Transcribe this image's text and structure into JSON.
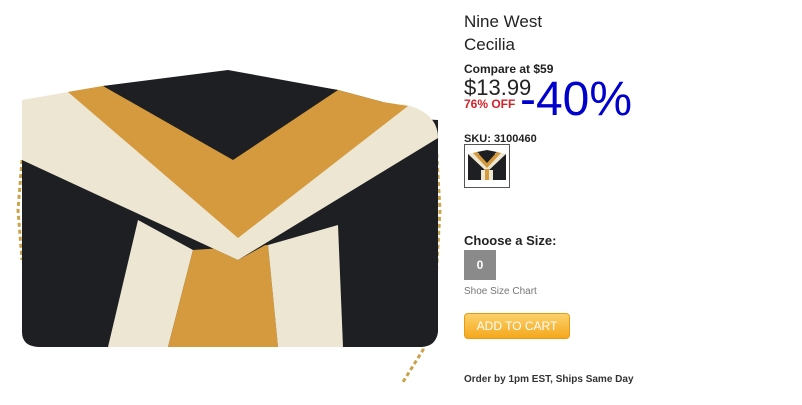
{
  "product": {
    "brand": "Nine West",
    "model": "Cecilia",
    "compare_at": "Compare at $59",
    "price": "$13.99",
    "percent_off": "76% OFF",
    "overlay_discount": "-40%",
    "sku": "SKU: 3100460"
  },
  "size": {
    "label": "Choose a Size:",
    "selected": "0",
    "chart_link": "Shoe Size Chart"
  },
  "cart": {
    "button_label": "ADD TO CART"
  },
  "shipping": {
    "note": "Order by 1pm EST, Ships Same Day"
  },
  "colors": {
    "black": "#1e1f22",
    "cream": "#ece6d2",
    "tan": "#d49a3d",
    "chain": "#c9a24a",
    "accent_red": "#d2232a",
    "overlay_blue": "#0000cc",
    "button_orange": "#f4a81c"
  }
}
